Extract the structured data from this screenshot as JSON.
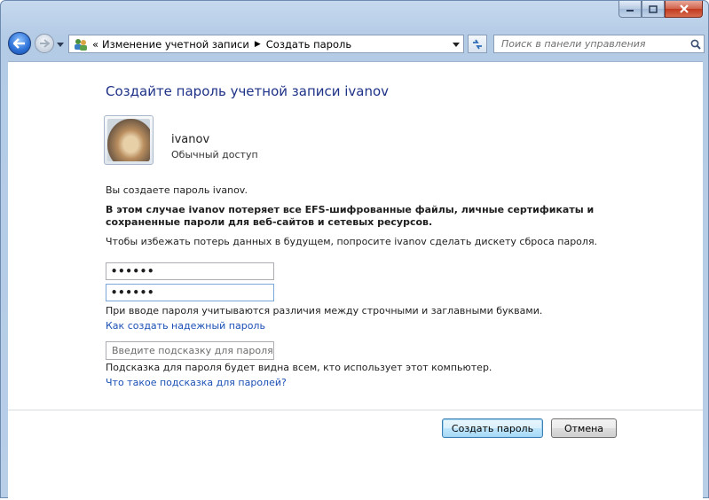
{
  "window": {
    "caption_buttons": [
      "minimize",
      "maximize",
      "close"
    ]
  },
  "address_bar": {
    "overflow_glyph": "«",
    "crumbs": [
      "Изменение учетной записи",
      "Создать пароль"
    ],
    "separator_glyph": "▶"
  },
  "search": {
    "placeholder": "Поиск в панели управления"
  },
  "content": {
    "title": "Создайте пароль учетной записи ivanov",
    "user": {
      "name": "ivanov",
      "access": "Обычный доступ"
    },
    "intro": "Вы создаете пароль ivanov.",
    "warning": "В этом случае ivanov потеряет все EFS-шифрованные файлы, личные сертификаты и сохраненные пароли для веб-сайтов и сетевых ресурсов.",
    "advice": "Чтобы избежать потерь данных в будущем, попросите ivanov сделать дискету сброса пароля.",
    "password": "••••••",
    "password_confirm": "••••••",
    "case_note": "При вводе пароля учитываются различия между строчными и заглавными буквами.",
    "strong_link": "Как создать надежный пароль",
    "hint_placeholder": "Введите подсказку для пароля",
    "hint_note": "Подсказка для пароля будет видна всем, кто использует этот компьютер.",
    "hint_link": "Что такое подсказка для паролей?"
  },
  "buttons": {
    "create": "Создать пароль",
    "cancel": "Отмена"
  },
  "colors": {
    "title": "#1e3287",
    "link": "#1a4fb5",
    "frame": "#b9cfe8"
  }
}
